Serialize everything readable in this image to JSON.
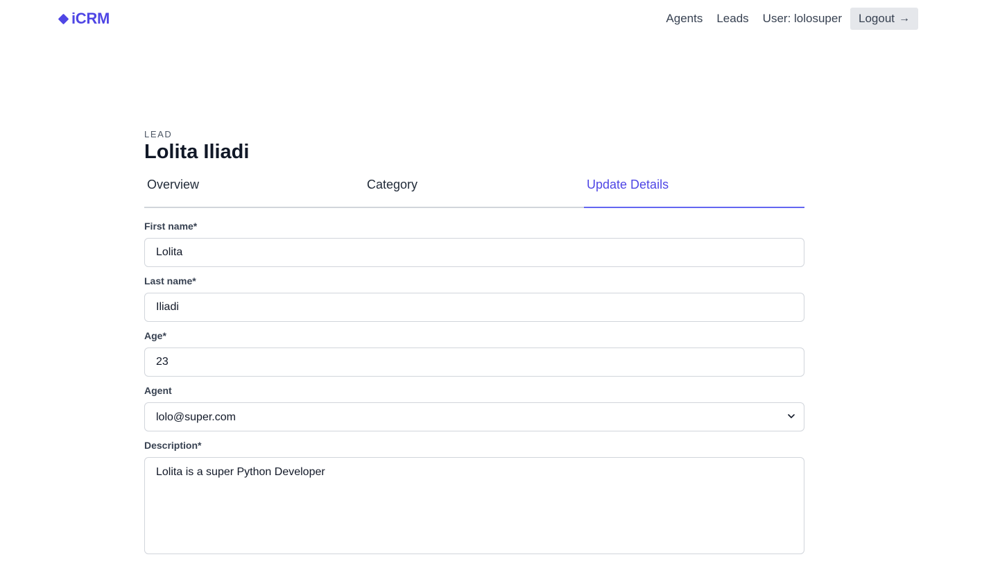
{
  "navbar": {
    "brand": "iCRM",
    "links": [
      {
        "label": "Agents"
      },
      {
        "label": "Leads"
      }
    ],
    "user": "User: lolosuper",
    "logout": "Logout",
    "logout_icon": "arrow-right-icon"
  },
  "page": {
    "overline": "LEAD",
    "title": "Lolita Iliadi"
  },
  "tabs": [
    {
      "label": "Overview",
      "active": false
    },
    {
      "label": "Category",
      "active": false
    },
    {
      "label": "Update Details",
      "active": true
    }
  ],
  "form": {
    "first_name": {
      "label": "First name*",
      "value": "Lolita"
    },
    "last_name": {
      "label": "Last name*",
      "value": "Iliadi"
    },
    "age": {
      "label": "Age*",
      "value": "23"
    },
    "agent": {
      "label": "Agent",
      "value": "lolo@super.com",
      "options": [
        "lolo@super.com"
      ]
    },
    "description": {
      "label": "Description*",
      "value": "Lolita is a super Python Developer"
    }
  },
  "colors": {
    "accent": "#4f46e5",
    "border": "#d1d5db",
    "logout_bg": "#e5e7eb"
  }
}
